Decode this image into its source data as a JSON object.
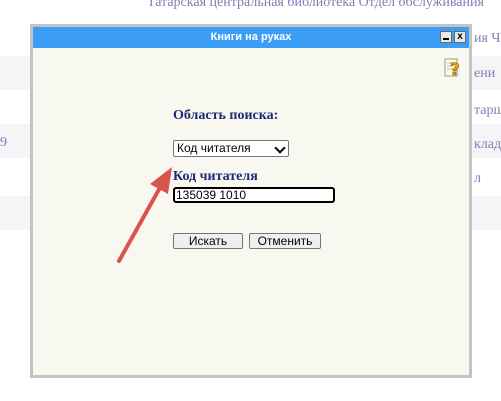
{
  "background": {
    "header_text": "Татарская центральная библиотека Отдел обслуживания",
    "fragments": [
      "ия Ч",
      "ени",
      "тарш",
      "клад",
      "л"
    ],
    "left_fragment": "9"
  },
  "dialog": {
    "title": "Книги на руках",
    "minimize_label": "_",
    "close_label": "x",
    "search_area_label": "Область поиска:",
    "search_area_value": "Код читателя",
    "field_label": "Код читателя",
    "field_value": "135039 1010",
    "search_button": "Искать",
    "cancel_button": "Отменить"
  },
  "colors": {
    "titlebar": "#3c9df6",
    "dialog_bg": "#f9f8f0",
    "label_color": "#1e2a78",
    "annotation_arrow": "#d9534f"
  },
  "icons": {
    "help": "help-question-icon",
    "annotation": "red-arrow-annotation"
  }
}
